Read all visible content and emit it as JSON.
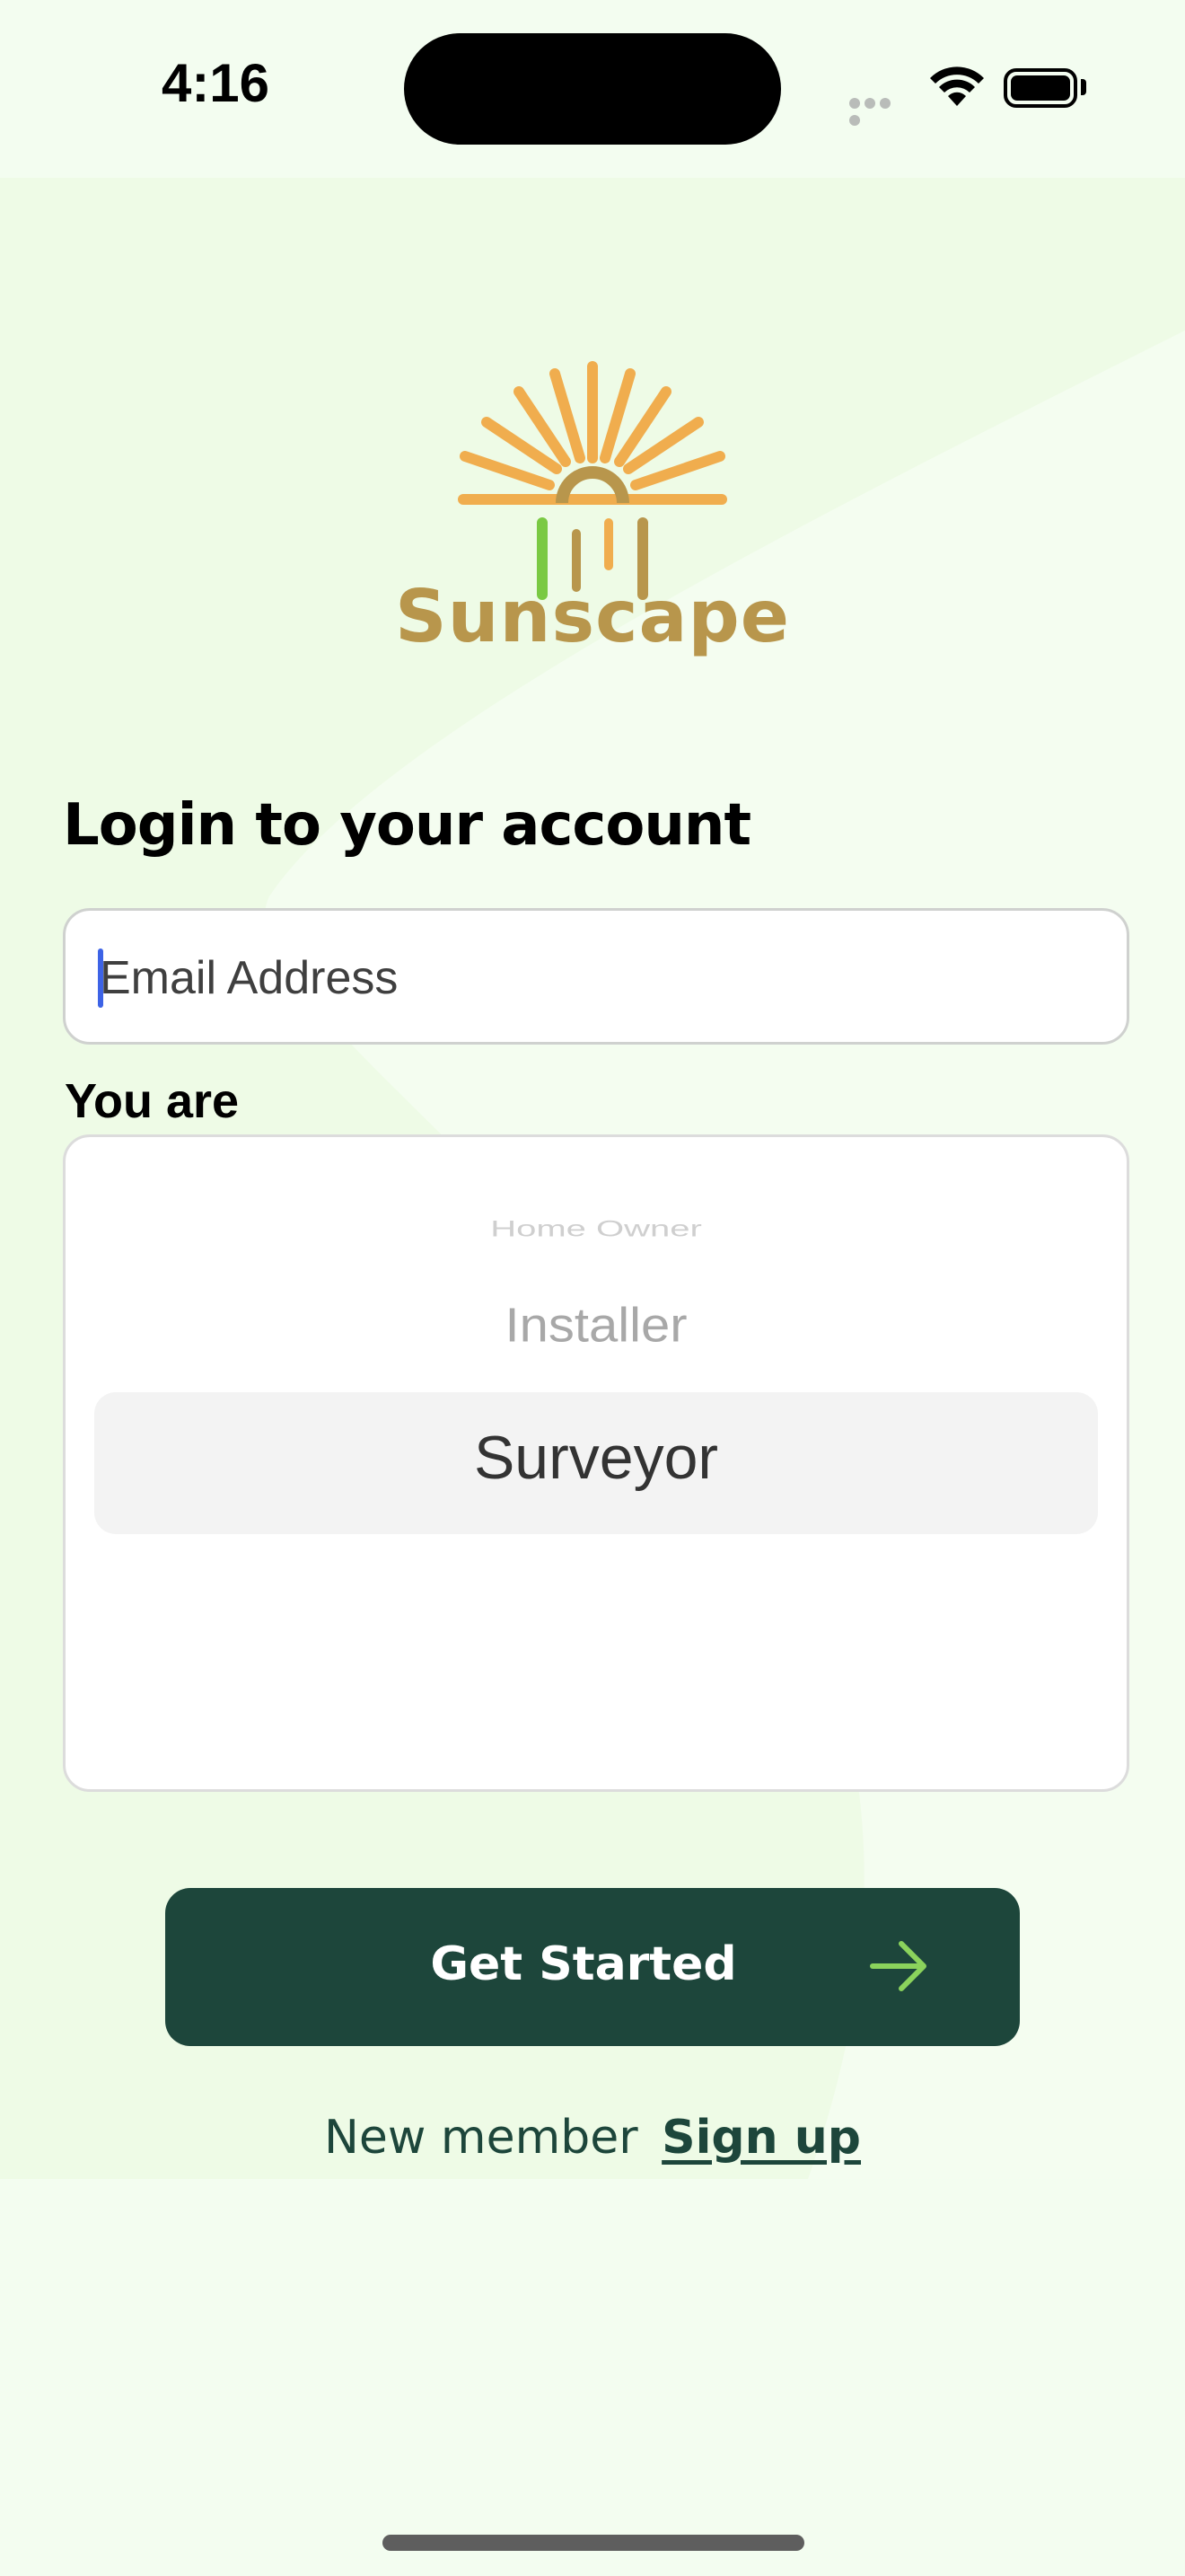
{
  "status_bar": {
    "time": "4:16"
  },
  "brand": {
    "name": "Sunscape",
    "colors": {
      "sun": "#f0ad4e",
      "text": "#b8964c",
      "bar_green": "#7ac943"
    }
  },
  "login": {
    "title": "Login to your account",
    "email_placeholder": "Email Address"
  },
  "role_picker": {
    "label": "You are",
    "options": [
      "Home Owner",
      "Installer",
      "Surveyor"
    ],
    "selected": "Surveyor"
  },
  "cta": {
    "label": "Get Started",
    "icon": "arrow-right-icon"
  },
  "signup": {
    "prompt": "New member",
    "link": "Sign up"
  },
  "colors": {
    "primary": "#1d463b",
    "background": "#eefbe6",
    "accent_arrow": "#8bd35c"
  }
}
